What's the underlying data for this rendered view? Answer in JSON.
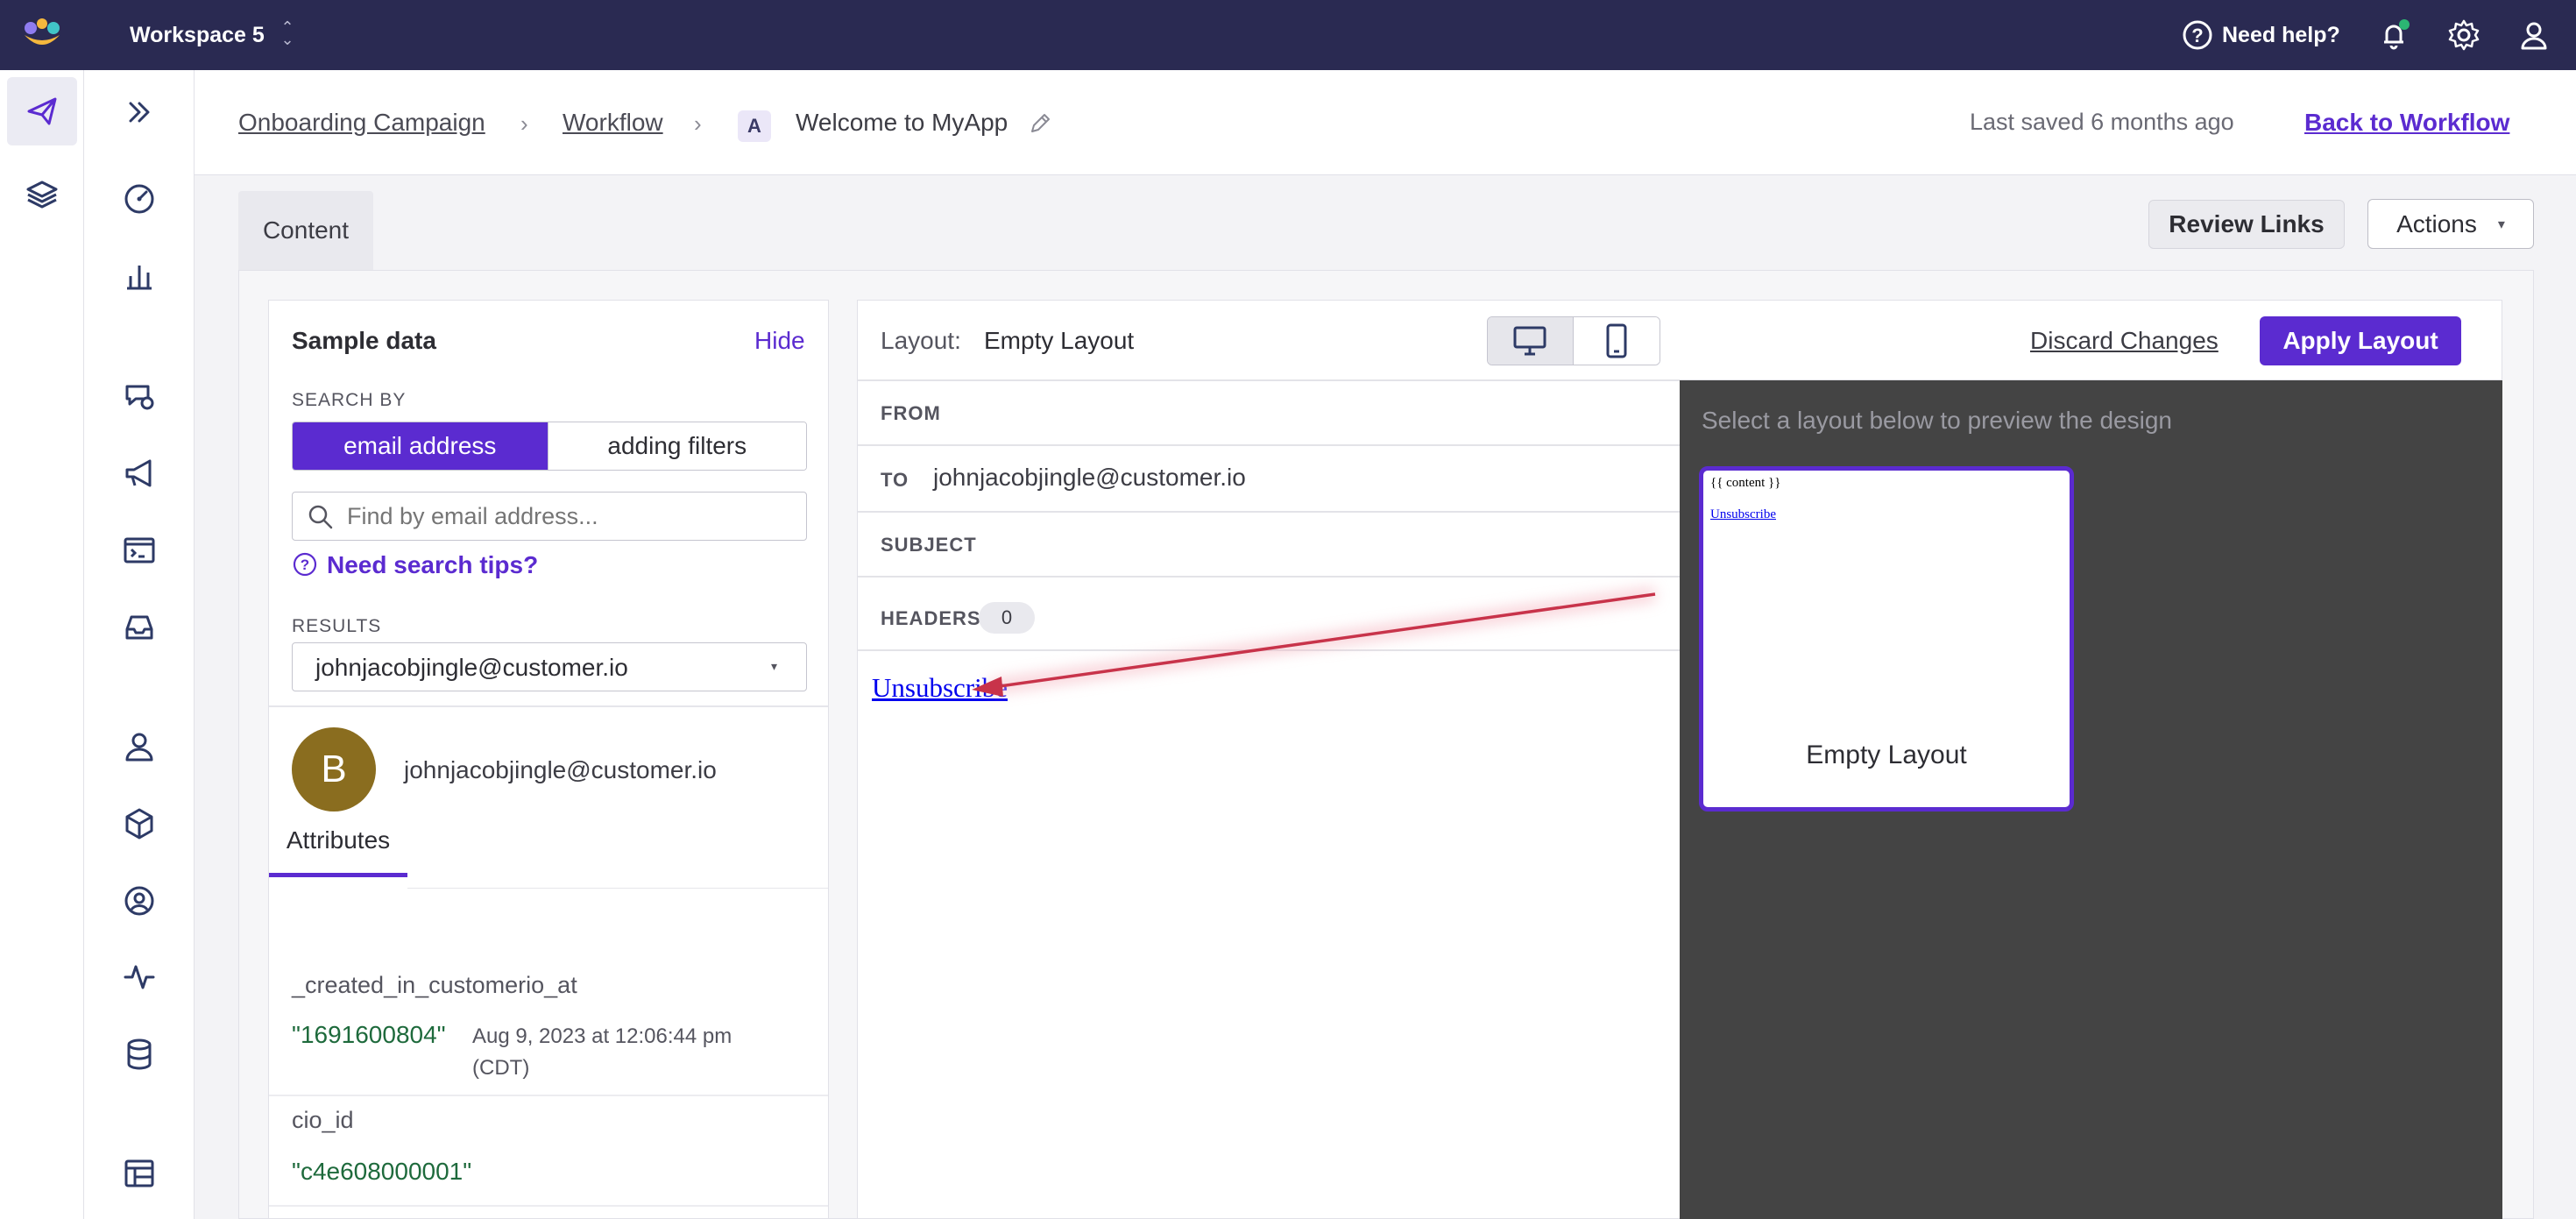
{
  "topbar": {
    "workspace": "Workspace 5",
    "help": "Need help?"
  },
  "breadcrumb": {
    "campaign": "Onboarding Campaign",
    "workflow": "Workflow",
    "badge": "A",
    "message": "Welcome to MyApp",
    "last_saved": "Last saved 6 months ago",
    "back": "Back to Workflow"
  },
  "tabs": {
    "content": "Content"
  },
  "actions": {
    "review_links": "Review Links",
    "actions": "Actions",
    "caret": "▾"
  },
  "sample_data": {
    "title": "Sample data",
    "hide": "Hide",
    "search_by": "SEARCH BY",
    "option_email": "email address",
    "option_filters": "adding filters",
    "search_placeholder": "Find by email address...",
    "tips": "Need search tips?",
    "results_label": "RESULTS",
    "results_value": "johnjacobjingle@customer.io",
    "avatar_letter": "B",
    "profile_email": "johnjacobjingle@customer.io",
    "attributes_tab": "Attributes",
    "attributes": [
      {
        "name": "_created_in_customerio_at",
        "value": "\"1691600804\"",
        "note": "Aug 9, 2023 at 12:06:44 pm (CDT)"
      },
      {
        "name": "cio_id",
        "value": "\"c4e608000001\""
      }
    ]
  },
  "editor": {
    "layout_label": "Layout:",
    "layout_value": "Empty Layout",
    "discard": "Discard Changes",
    "apply": "Apply Layout",
    "from_label": "FROM",
    "to_label": "TO",
    "to_value": "johnjacobjingle@customer.io",
    "subject_label": "SUBJECT",
    "headers_label": "HEADERS",
    "headers_count": "0",
    "unsubscribe": "Unsubscribe"
  },
  "preview": {
    "hint": "Select a layout below to preview the design",
    "thumb_content": "{{ content }}",
    "thumb_unsubscribe": "Unsubscribe",
    "thumb_title": "Empty Layout"
  },
  "colors": {
    "topbar": "#2a2a52",
    "accent": "#5b2bd0",
    "value_green": "#1e6a3c",
    "arrow": "#c8334a",
    "preview_bg": "#444444",
    "avatar": "#8a6d1f"
  }
}
